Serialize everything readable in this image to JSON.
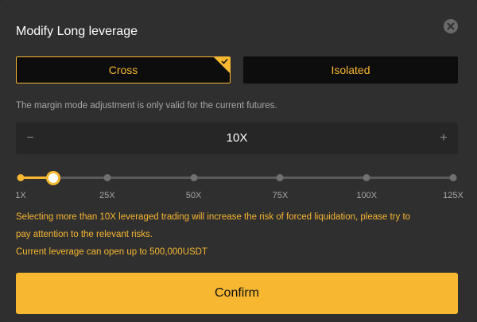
{
  "dialog": {
    "title": "Modify Long leverage",
    "close_icon": "close-icon"
  },
  "margin_modes": [
    {
      "label": "Cross",
      "selected": true
    },
    {
      "label": "Isolated",
      "selected": false
    }
  ],
  "hint_text": "The margin mode adjustment is only valid for the current futures.",
  "stepper": {
    "minus": "−",
    "value": "10X",
    "plus": "+"
  },
  "slider": {
    "ticks": [
      "1X",
      "25X",
      "50X",
      "75X",
      "100X",
      "125X"
    ],
    "current_value": 10
  },
  "warnings": {
    "line1": "Selecting more than 10X leveraged trading will increase the risk of forced liquidation, please try to",
    "line2": "pay attention to the relevant risks.",
    "line3": "Current leverage can open up to 500,000USDT"
  },
  "confirm_label": "Confirm",
  "colors": {
    "accent": "#f7b731",
    "background": "#2f2f2f"
  }
}
